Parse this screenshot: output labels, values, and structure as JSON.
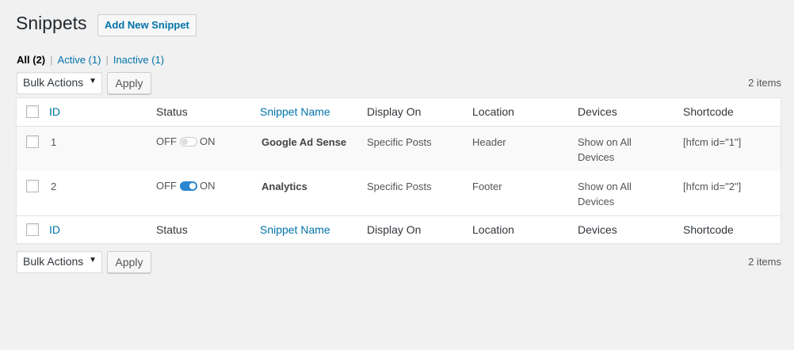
{
  "page": {
    "title": "Snippets",
    "add_new_label": "Add New Snippet"
  },
  "filters": {
    "all": {
      "label": "All",
      "count": "(2)"
    },
    "active": {
      "label": "Active (1)"
    },
    "inactive": {
      "label": "Inactive (1)"
    },
    "separator": "|"
  },
  "bulk": {
    "select_value": "Bulk Actions",
    "apply_label": "Apply",
    "items_count": "2 items"
  },
  "table": {
    "columns": {
      "id": "ID",
      "status": "Status",
      "name": "Snippet Name",
      "display_on": "Display On",
      "location": "Location",
      "devices": "Devices",
      "shortcode": "Shortcode"
    },
    "toggle": {
      "off_label": "OFF",
      "on_label": "ON"
    },
    "rows": [
      {
        "id": "1",
        "status": "off",
        "name": "Google Ad Sense",
        "display_on": "Specific Posts",
        "location": "Header",
        "devices_line1": "Show on All",
        "devices_line2": "Devices",
        "shortcode": "[hfcm id=\"1\"]"
      },
      {
        "id": "2",
        "status": "on",
        "name": "Analytics",
        "display_on": "Specific Posts",
        "location": "Footer",
        "devices_line1": "Show on All",
        "devices_line2": "Devices",
        "shortcode": "[hfcm id=\"2\"]"
      }
    ]
  },
  "colors": {
    "link": "#0073aa",
    "toggle_on": "#2c87d2",
    "background": "#f1f1f1"
  },
  "icons": {
    "dropdown": "caret-down-icon"
  }
}
